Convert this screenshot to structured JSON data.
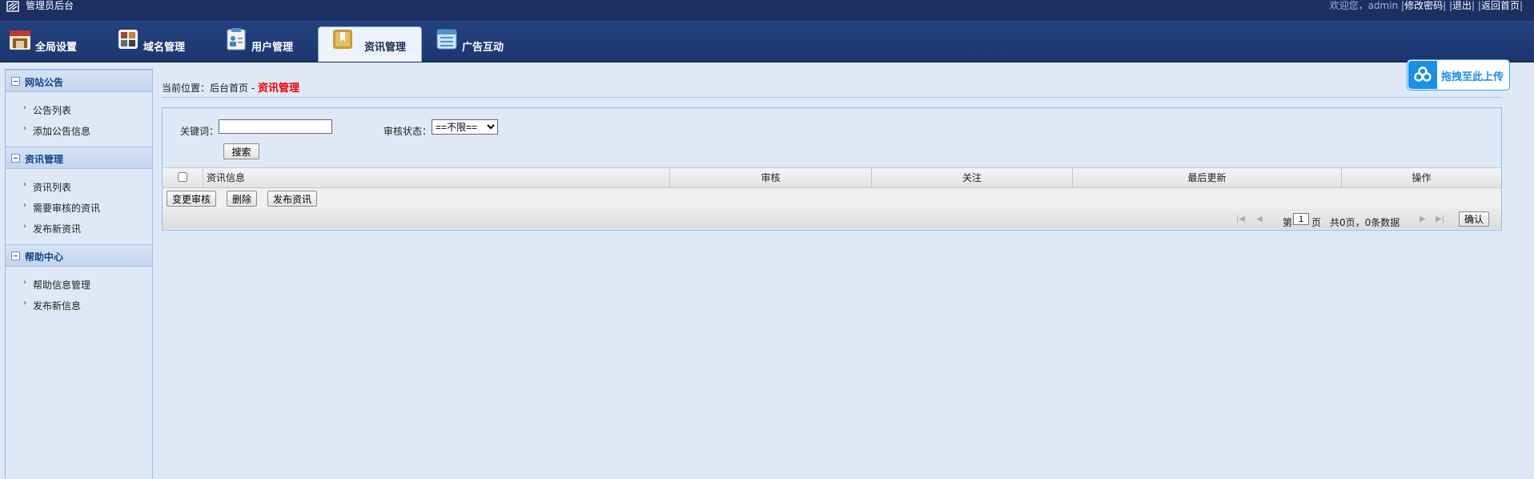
{
  "topbar": {
    "title": "管理员后台",
    "welcome": "欢迎您，admin",
    "links": [
      "修改密码",
      "退出",
      "返回首页"
    ]
  },
  "tabs": [
    {
      "label": "全局设置",
      "icon": "settings-icon"
    },
    {
      "label": "域名管理",
      "icon": "grid-icon"
    },
    {
      "label": "用户管理",
      "icon": "user-icon"
    },
    {
      "label": "资讯管理",
      "icon": "bookmark-icon",
      "active": true
    },
    {
      "label": "广告互动",
      "icon": "list-icon"
    }
  ],
  "sidebar": {
    "sections": [
      {
        "title": "网站公告",
        "items": [
          "公告列表",
          "添加公告信息"
        ]
      },
      {
        "title": "资讯管理",
        "items": [
          "资讯列表",
          "需要审核的资讯",
          "发布新资讯"
        ]
      },
      {
        "title": "帮助中心",
        "items": [
          "帮助信息管理",
          "发布新信息"
        ]
      }
    ]
  },
  "breadcrumb": {
    "prefix": "当前位置：后台首页 - ",
    "current": "资讯管理"
  },
  "upload_button": {
    "label": "拖拽至此上传"
  },
  "search": {
    "keyword_label": "关键词：",
    "keyword_value": "",
    "status_label": "审核状态：",
    "status_selected": "==不限==",
    "button": "搜索"
  },
  "grid": {
    "columns": [
      "资讯信息",
      "审核",
      "关注",
      "最后更新",
      "操作"
    ],
    "toolbar": [
      "变更审核",
      "删除",
      "发布资讯"
    ]
  },
  "pager": {
    "di": "第",
    "page": "1",
    "ye": "页",
    "info": "共0页，0条数据",
    "confirm": "确认"
  },
  "colors": {
    "topbar_bg": "#1c2f63",
    "accent_blue": "#15428b",
    "current_red": "#e00000",
    "upload_blue": "#1a8fe8"
  }
}
